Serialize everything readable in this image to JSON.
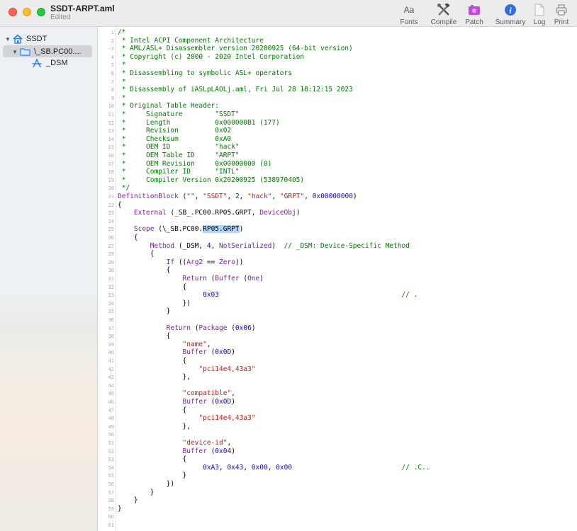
{
  "window": {
    "title": "SSDT-ARPT.aml",
    "subtitle": "Edited"
  },
  "toolbar": {
    "fonts_glyph": "Aa",
    "items": [
      {
        "label": "Fonts",
        "icon": "font-icon"
      },
      {
        "label": "Compile",
        "icon": "hammer-wrench-icon"
      },
      {
        "label": "Patch",
        "icon": "patch-icon"
      },
      {
        "label": "Summary",
        "icon": "info-icon"
      },
      {
        "label": "Log",
        "icon": "document-icon"
      },
      {
        "label": "Print",
        "icon": "printer-icon"
      }
    ]
  },
  "sidebar": {
    "items": [
      {
        "label": "SSDT",
        "icon": "home-icon"
      },
      {
        "label": "\\_SB.PC00....",
        "icon": "folder-icon"
      },
      {
        "label": "_DSM",
        "icon": "method-icon"
      }
    ]
  },
  "code": {
    "lines": [
      "/*",
      " * Intel ACPI Component Architecture",
      " * AML/ASL+ Disassembler version 20200925 (64-bit version)",
      " * Copyright (c) 2000 - 2020 Intel Corporation",
      " *",
      " * Disassembling to symbolic ASL+ operators",
      " *",
      " * Disassembly of iASLpLAOLj.aml, Fri Jul 28 18:12:15 2023",
      " *",
      " * Original Table Header:",
      " *     Signature        \"SSDT\"",
      " *     Length           0x000000B1 (177)",
      " *     Revision         0x02",
      " *     Checksum         0xA0",
      " *     OEM ID           \"hack\"",
      " *     OEM Table ID     \"ARPT\"",
      " *     OEM Revision     0x00000000 (0)",
      " *     Compiler ID      \"INTL\"",
      " *     Compiler Version 0x20200925 (538970405)",
      " */",
      "DefinitionBlock (\"\", \"SSDT\", 2, \"hack\", \"GRPT\", 0x00000000)",
      "{",
      "    External (_SB_.PC00.RP05.GRPT, DeviceObj)",
      "",
      "    Scope (\\_SB.PC00.RP05.GRPT)",
      "    {",
      "        Method (_DSM, 4, NotSerialized)  // _DSM: Device-Specific Method",
      "        {",
      "            If ((Arg2 == Zero))",
      "            {",
      "                Return (Buffer (One)",
      "                {",
      "                     0x03                                             // .",
      "                })",
      "            }",
      "",
      "            Return (Package (0x06)",
      "            {",
      "                \"name\",",
      "                Buffer (0x0D)",
      "                {",
      "                    \"pci14e4,43a3\"",
      "                },",
      "",
      "                \"compatible\",",
      "                Buffer (0x0D)",
      "                {",
      "                    \"pci14e4,43a3\"",
      "                },",
      "",
      "                \"device-id\",",
      "                Buffer (0x04)",
      "                {",
      "                     0xA3, 0x43, 0x00, 0x00                           // .C..",
      "                }",
      "            })",
      "        }",
      "    }",
      "}",
      "",
      ""
    ]
  },
  "colors": {
    "comment": "#007a00",
    "keyword": "#7b1fa2",
    "string": "#c41a16",
    "number": "#1c00cf",
    "selection": "#b5d5ff"
  }
}
